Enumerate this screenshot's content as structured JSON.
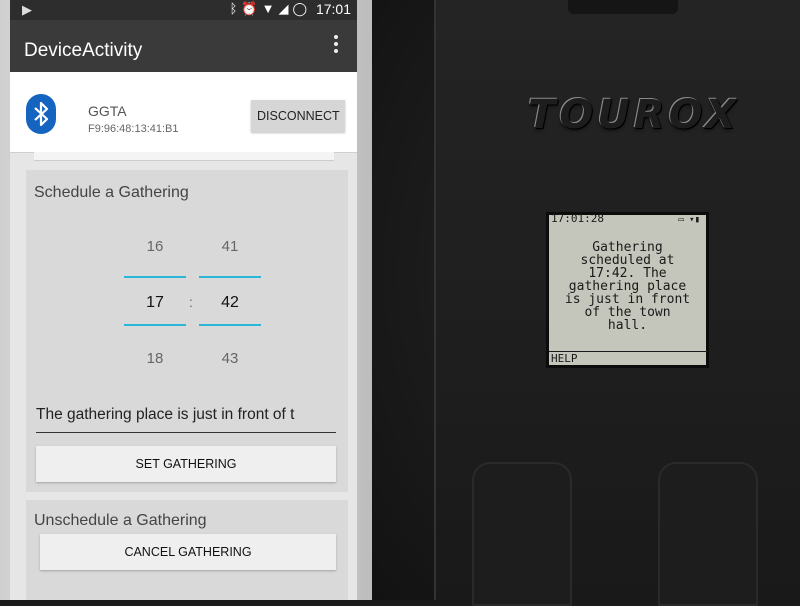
{
  "phone": {
    "status_time": "17:01",
    "app_title": "DeviceActivity",
    "device": {
      "name": "GGTA",
      "mac": "F9:96:48:13:41:B1",
      "disconnect_label": "DISCONNECT"
    },
    "schedule": {
      "title": "Schedule a Gathering",
      "hours": [
        "16",
        "17",
        "18"
      ],
      "minutes": [
        "41",
        "42",
        "43"
      ],
      "separator": ":",
      "message": "The gathering place is just in front of t",
      "set_label": "SET GATHERING"
    },
    "unschedule": {
      "title": "Unschedule a Gathering",
      "cancel_label": "CANCEL GATHERING"
    }
  },
  "device": {
    "brand": "TOUROX",
    "lcd_time": "17:01:28",
    "lcd_message": "Gathering\nscheduled at\n17:42. The\ngathering place\nis just in front\nof the town\nhall.",
    "lcd_softkey": "HELP"
  },
  "colors": {
    "picker_accent": "#29b6d8",
    "bluetooth_blue": "#1565c0",
    "lcd_background": "#c4c6bb"
  }
}
